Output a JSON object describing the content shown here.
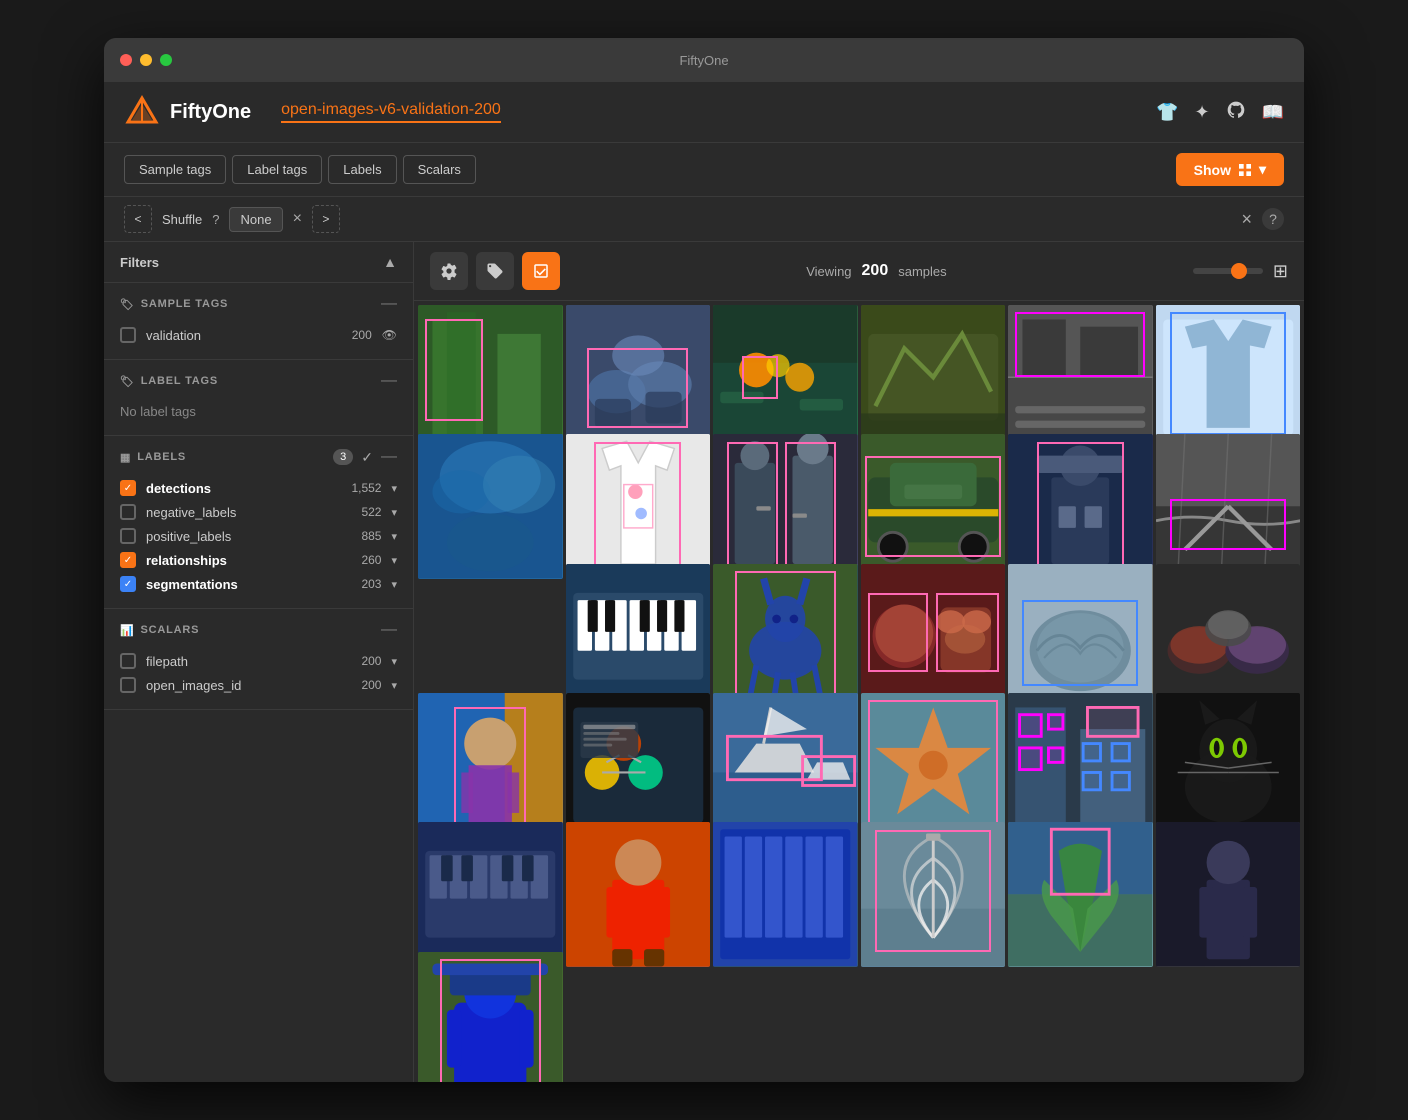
{
  "window": {
    "title": "FiftyOne"
  },
  "header": {
    "app_name": "FiftyOne",
    "dataset_name": "open-images-v6-validation-200",
    "icons": [
      "shirt-icon",
      "grid-icon",
      "github-icon",
      "book-icon"
    ]
  },
  "toolbar": {
    "tabs": [
      "Sample tags",
      "Label tags",
      "Labels",
      "Scalars"
    ],
    "show_button": "Show"
  },
  "shuffle_bar": {
    "prev_label": "<",
    "next_label": ">",
    "shuffle_label": "Shuffle",
    "help_label": "?",
    "select_value": "None",
    "close_label": "×",
    "help_right": "?"
  },
  "sidebar": {
    "filters_label": "Filters",
    "sections": {
      "sample_tags": {
        "title": "SAMPLE TAGS",
        "items": [
          {
            "name": "validation",
            "count": "200",
            "checked": false
          }
        ]
      },
      "label_tags": {
        "title": "LABEL TAGS",
        "no_tags_text": "No label tags"
      },
      "labels": {
        "title": "LABELS",
        "badge": "3",
        "items": [
          {
            "name": "detections",
            "count": "1,552",
            "checked": true,
            "color": "orange"
          },
          {
            "name": "negative_labels",
            "count": "522",
            "checked": false
          },
          {
            "name": "positive_labels",
            "count": "885",
            "checked": false
          },
          {
            "name": "relationships",
            "count": "260",
            "checked": true,
            "color": "orange"
          },
          {
            "name": "segmentations",
            "count": "203",
            "checked": true,
            "color": "blue"
          }
        ]
      },
      "scalars": {
        "title": "SCALARS",
        "items": [
          {
            "name": "filepath",
            "count": "200"
          },
          {
            "name": "open_images_id",
            "count": "200"
          }
        ]
      }
    }
  },
  "content": {
    "viewing_text": "Viewing",
    "sample_count": "200",
    "samples_label": "samples",
    "grid_cells": [
      {
        "class": "cell-1",
        "span": false
      },
      {
        "class": "cell-2",
        "span": false
      },
      {
        "class": "cell-3",
        "span": false
      },
      {
        "class": "cell-4",
        "span": false
      },
      {
        "class": "cell-5",
        "span": false
      },
      {
        "class": "cell-6",
        "span": false
      },
      {
        "class": "cell-7",
        "span": true
      },
      {
        "class": "cell-8",
        "span": false
      },
      {
        "class": "cell-9",
        "span": false
      },
      {
        "class": "cell-10",
        "span": false
      },
      {
        "class": "cell-11",
        "span": false
      },
      {
        "class": "cell-12",
        "span": false
      },
      {
        "class": "cell-13",
        "span": false
      },
      {
        "class": "cell-14",
        "span": false
      },
      {
        "class": "cell-15",
        "span": false
      },
      {
        "class": "cell-16",
        "span": false
      },
      {
        "class": "cell-17",
        "span": false
      },
      {
        "class": "cell-18",
        "span": false
      },
      {
        "class": "cell-19",
        "span": false
      },
      {
        "class": "cell-20",
        "span": false
      },
      {
        "class": "cell-21",
        "span": false
      },
      {
        "class": "cell-22",
        "span": false
      },
      {
        "class": "cell-23",
        "span": false
      },
      {
        "class": "cell-24",
        "span": false
      },
      {
        "class": "cell-25",
        "span": false
      },
      {
        "class": "cell-26",
        "span": false
      },
      {
        "class": "cell-27",
        "span": false
      },
      {
        "class": "cell-28",
        "span": false
      },
      {
        "class": "cell-29",
        "span": false
      },
      {
        "class": "cell-30",
        "span": false
      }
    ]
  },
  "colors": {
    "accent": "#f97316",
    "bg_dark": "#2a2a2a",
    "bg_darker": "#1a1a1a",
    "text_primary": "#ffffff",
    "text_secondary": "#aaaaaa"
  }
}
